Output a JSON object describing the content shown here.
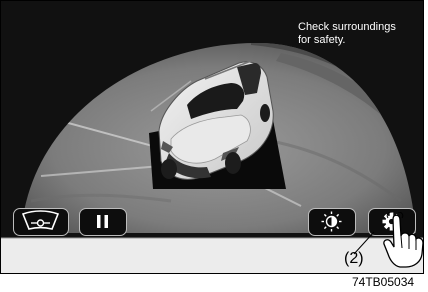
{
  "screen": {
    "message": "Check surroundings\nfor safety."
  },
  "toolbar": {
    "view_button": {
      "icon": "camera-view-icon"
    },
    "pause_button": {
      "icon": "pause-icon"
    },
    "brightness_button": {
      "icon": "brightness-icon"
    },
    "settings_button": {
      "icon": "gear-icon"
    }
  },
  "annotation": {
    "callout_label": "(2)",
    "figure_code": "74TB05034"
  },
  "colors": {
    "screen_background": "#111111",
    "bar_background": "#ececec",
    "message_text": "#ffffff"
  }
}
